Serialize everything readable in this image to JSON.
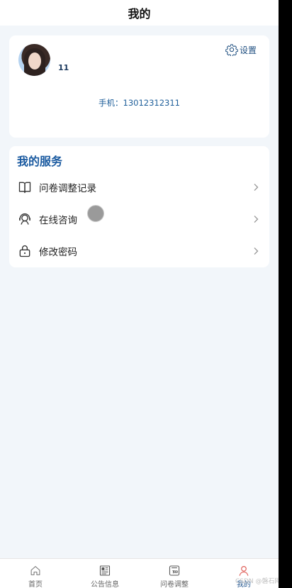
{
  "header": {
    "title": "我的"
  },
  "profile": {
    "username": "11",
    "settings_label": "设置",
    "phone": "手机：13012312311"
  },
  "services": {
    "title": "我的服务",
    "items": [
      {
        "label": "问卷调整记录",
        "icon": "book-icon"
      },
      {
        "label": "在线咨询",
        "icon": "headset-icon"
      },
      {
        "label": "修改密码",
        "icon": "lock-icon"
      }
    ]
  },
  "tabbar": {
    "items": [
      {
        "label": "首页",
        "icon": "home-icon"
      },
      {
        "label": "公告信息",
        "icon": "news-icon"
      },
      {
        "label": "问卷调整",
        "icon": "survey-icon"
      },
      {
        "label": "我的",
        "icon": "user-icon"
      }
    ],
    "active_index": 3
  },
  "watermark": "CSDN @磐石网络",
  "colors": {
    "accent": "#1a5aa0",
    "background": "#f2f6fa",
    "active_tab_icon": "#e0605a"
  }
}
